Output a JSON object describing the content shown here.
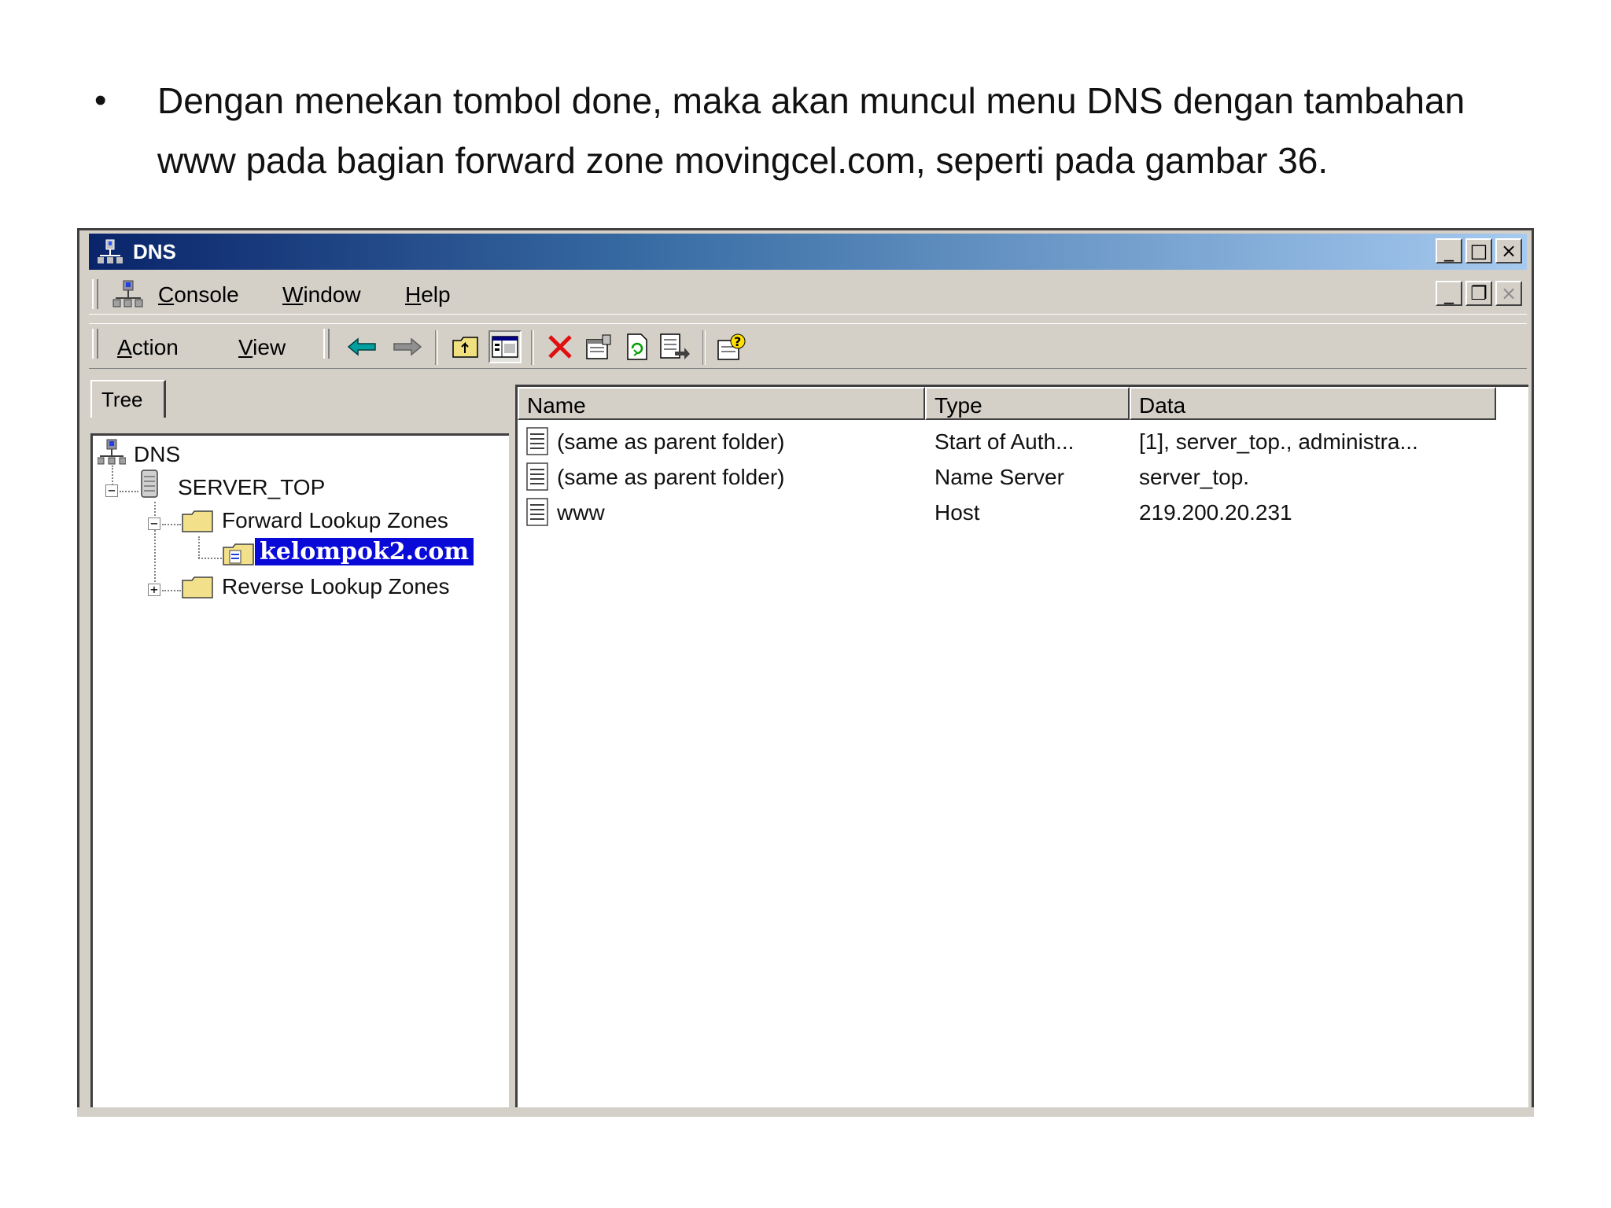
{
  "slide": {
    "bullet": "•",
    "text": "Dengan menekan tombol done, maka akan muncul menu DNS dengan tambahan www pada bagian forward zone movingcel.com, seperti pada gambar 36."
  },
  "window": {
    "title": "DNS",
    "controls": {
      "minimize": "_",
      "maximize": "□",
      "close": "×"
    },
    "mdi_controls": {
      "minimize": "_",
      "restore": "❐",
      "close": "×"
    }
  },
  "menubar": {
    "console": {
      "key": "C",
      "rest": "onsole"
    },
    "window": {
      "key": "W",
      "rest": "indow"
    },
    "help": {
      "key": "H",
      "rest": "elp"
    }
  },
  "toolbar": {
    "action": {
      "key": "A",
      "rest": "ction"
    },
    "view": {
      "key": "V",
      "rest": "iew"
    },
    "buttons": [
      "back-icon",
      "forward-icon",
      "up-folder-icon",
      "show-tree-icon",
      "delete-icon",
      "properties-icon",
      "refresh-icon",
      "export-list-icon",
      "help-icon"
    ]
  },
  "tree": {
    "tab_label": "Tree",
    "root": "DNS",
    "server": "SERVER_TOP",
    "forward_zones": "Forward Lookup Zones",
    "zone": "kelompok2.com",
    "reverse_zones": "Reverse Lookup Zones"
  },
  "list": {
    "columns": [
      "Name",
      "Type",
      "Data"
    ],
    "rows": [
      {
        "name": "(same as parent folder)",
        "type": "Start of Auth...",
        "data": "[1], server_top., administra..."
      },
      {
        "name": "(same as parent folder)",
        "type": "Name Server",
        "data": "server_top."
      },
      {
        "name": "www",
        "type": "Host",
        "data": "219.200.20.231"
      }
    ]
  },
  "colors": {
    "title_start": "#0a246a",
    "title_end": "#a6caf0",
    "selection": "#0a0ad8",
    "chrome": "#d4d0c8",
    "delete_red": "#e01010",
    "arrow_teal": "#00a0a0"
  }
}
